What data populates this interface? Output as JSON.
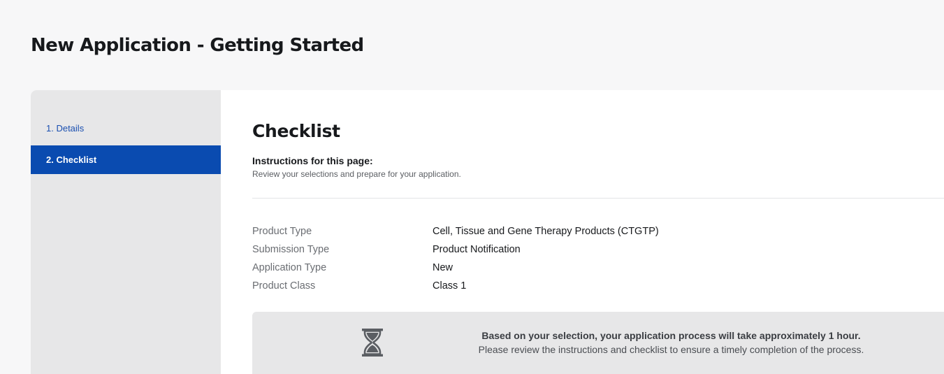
{
  "page": {
    "title": "New Application - Getting Started"
  },
  "sidebar": {
    "steps": [
      {
        "label": "1. Details",
        "active": false
      },
      {
        "label": "2. Checklist",
        "active": true
      }
    ]
  },
  "checklist": {
    "title": "Checklist",
    "instructions_title": "Instructions for this page:",
    "instructions_text": "Review your selections and prepare for your application.",
    "summary": [
      {
        "label": "Product Type",
        "value": "Cell, Tissue and Gene Therapy Products (CTGTP)"
      },
      {
        "label": "Submission Type",
        "value": "Product Notification"
      },
      {
        "label": "Application Type",
        "value": "New"
      },
      {
        "label": "Product Class",
        "value": "Class 1"
      }
    ],
    "notice": {
      "icon": "hourglass-icon",
      "headline": "Based on your selection, your application process will take approximately 1 hour.",
      "subtext": "Please review the instructions and checklist to ensure a timely completion of the process."
    }
  },
  "colors": {
    "accent": "#0a4bb0",
    "sidebar_bg": "#e7e7e8",
    "page_bg": "#f7f7f8",
    "icon": "#5b5e63"
  }
}
